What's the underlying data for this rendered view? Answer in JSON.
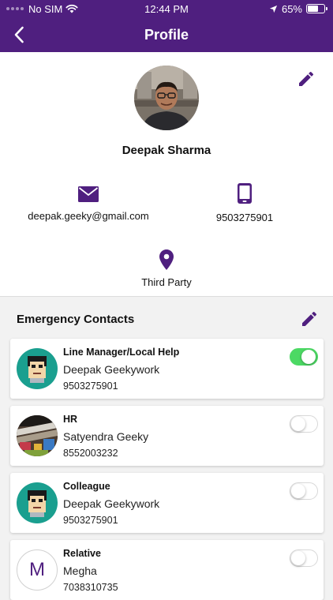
{
  "status_bar": {
    "carrier": "No SIM",
    "time": "12:44 PM",
    "battery": "65%",
    "battery_level": 0.65
  },
  "nav": {
    "title": "Profile"
  },
  "profile": {
    "name": "Deepak Sharma",
    "email": "deepak.geeky@gmail.com",
    "phone": "9503275901",
    "location": "Third Party"
  },
  "emergency": {
    "title": "Emergency Contacts",
    "contacts": [
      {
        "relation": "Line Manager/Local Help",
        "name": "Deepak Geekywork",
        "phone": "9503275901",
        "enabled": true,
        "avatar": "cartoon-face"
      },
      {
        "relation": "HR",
        "name": "Satyendra Geeky",
        "phone": "8552003232",
        "enabled": false,
        "avatar": "photo"
      },
      {
        "relation": "Colleague",
        "name": "Deepak Geekywork",
        "phone": "9503275901",
        "enabled": false,
        "avatar": "cartoon-face"
      },
      {
        "relation": "Relative",
        "name": "Megha",
        "phone": "7038310735",
        "enabled": false,
        "avatar": "initial",
        "initial": "M"
      }
    ]
  },
  "colors": {
    "brand": "#4f1f7f",
    "toggle_on": "#4cd964",
    "avatar_teal": "#1a9f8f"
  }
}
